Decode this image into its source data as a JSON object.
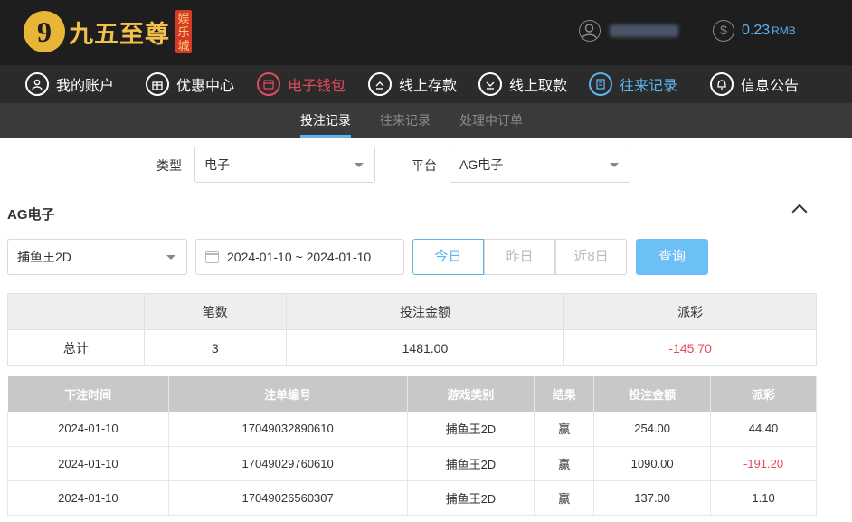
{
  "header": {
    "logo_mark": "9",
    "logo_text": "九五至尊",
    "logo_badge": "娱乐城",
    "balance_value": "0.23",
    "balance_unit": "RMB",
    "balance_color": "#5bb4f0"
  },
  "nav": {
    "items": [
      {
        "label": "我的账户",
        "icon": "user-icon"
      },
      {
        "label": "优惠中心",
        "icon": "gift-icon"
      },
      {
        "label": "电子钱包",
        "icon": "wallet-icon"
      },
      {
        "label": "线上存款",
        "icon": "deposit-icon"
      },
      {
        "label": "线上取款",
        "icon": "withdraw-icon"
      },
      {
        "label": "往来记录",
        "icon": "records-icon"
      },
      {
        "label": "信息公告",
        "icon": "bell-icon"
      }
    ]
  },
  "subnav": {
    "items": [
      "投注记录",
      "往来记录",
      "处理中订单"
    ]
  },
  "filters": {
    "type_label": "类型",
    "type_value": "电子",
    "platform_label": "平台",
    "platform_value": "AG电子"
  },
  "section": {
    "title": "AG电子"
  },
  "search": {
    "game_value": "捕鱼王2D",
    "date_range": "2024-01-10 ~ 2024-01-10",
    "quick_today": "今日",
    "quick_yesterday": "昨日",
    "quick_8days": "近8日",
    "query_label": "查询"
  },
  "summary": {
    "headers": [
      "",
      "笔数",
      "投注金额",
      "派彩"
    ],
    "row": {
      "label": "总计",
      "count": "3",
      "amount": "1481.00",
      "payout": "-145.70"
    }
  },
  "detail": {
    "headers": [
      "下注时间",
      "注单编号",
      "游戏类别",
      "结果",
      "投注金额",
      "派彩"
    ],
    "rows": [
      [
        "2024-01-10",
        "17049032890610",
        "捕鱼王2D",
        "赢",
        "254.00",
        "44.40"
      ],
      [
        "2024-01-10",
        "17049029760610",
        "捕鱼王2D",
        "赢",
        "1090.00",
        "-191.20"
      ],
      [
        "2024-01-10",
        "17049026560307",
        "捕鱼王2D",
        "赢",
        "137.00",
        "1.10"
      ]
    ]
  },
  "colors": {
    "accent": "#5bb4f0",
    "negative": "#e5495e",
    "header_bg": "#1e1e1e",
    "logo_gold": "#f1c14b"
  }
}
